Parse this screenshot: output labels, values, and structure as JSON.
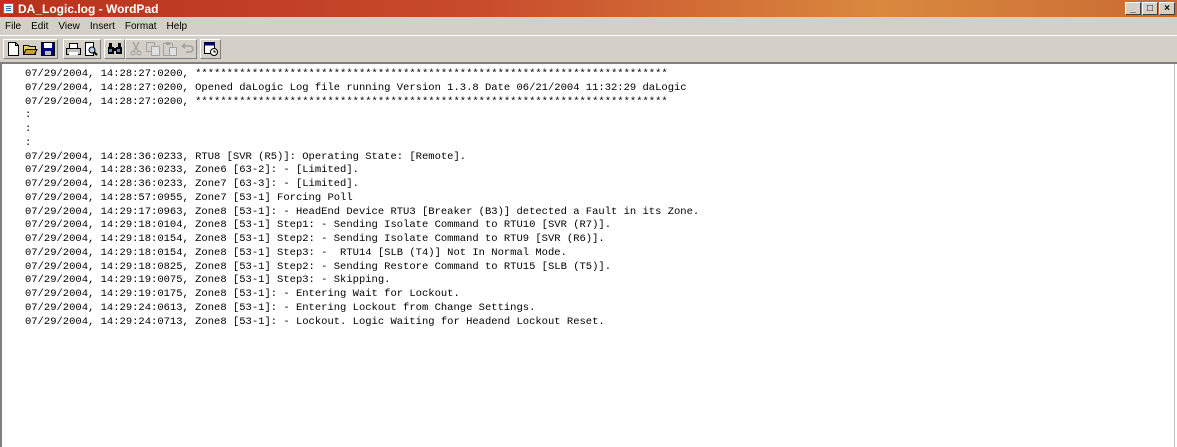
{
  "window": {
    "title": "DA_Logic.log - WordPad",
    "min_glyph": "_",
    "max_glyph": "□",
    "close_glyph": "×"
  },
  "menu": [
    "File",
    "Edit",
    "View",
    "Insert",
    "Format",
    "Help"
  ],
  "toolbar": {
    "buttons": [
      {
        "name": "new-document-icon",
        "enabled": true
      },
      {
        "name": "open-folder-icon",
        "enabled": true
      },
      {
        "name": "save-icon",
        "enabled": true
      },
      {
        "name": "print-icon",
        "enabled": true
      },
      {
        "name": "print-preview-icon",
        "enabled": true
      },
      {
        "name": "find-icon",
        "enabled": true
      },
      {
        "name": "cut-icon",
        "enabled": false
      },
      {
        "name": "copy-icon",
        "enabled": false
      },
      {
        "name": "paste-icon",
        "enabled": false
      },
      {
        "name": "undo-icon",
        "enabled": false
      },
      {
        "name": "insert-datetime-icon",
        "enabled": true
      }
    ]
  },
  "document": {
    "lines": [
      "07/29/2004, 14:28:27:0200, ***************************************************************************",
      "07/29/2004, 14:28:27:0200, Opened daLogic Log file running Version 1.3.8 Date 06/21/2004 11:32:29 daLogic",
      "07/29/2004, 14:28:27:0200, ***************************************************************************",
      ":",
      ":",
      ":",
      "07/29/2004, 14:28:36:0233, RTU8 [SVR (R5)]: Operating State: [Remote].",
      "07/29/2004, 14:28:36:0233, Zone6 [63-2]: - [Limited].",
      "07/29/2004, 14:28:36:0233, Zone7 [63-3]: - [Limited].",
      "07/29/2004, 14:28:57:0955, Zone7 [53-1] Forcing Poll",
      "07/29/2004, 14:29:17:0963, Zone8 [53-1]: - HeadEnd Device RTU3 [Breaker (B3)] detected a Fault in its Zone.",
      "07/29/2004, 14:29:18:0104, Zone8 [53-1] Step1: - Sending Isolate Command to RTU10 [SVR (R7)].",
      "07/29/2004, 14:29:18:0154, Zone8 [53-1] Step2: - Sending Isolate Command to RTU9 [SVR (R6)].",
      "07/29/2004, 14:29:18:0154, Zone8 [53-1] Step3: -  RTU14 [SLB (T4)] Not In Normal Mode.",
      "07/29/2004, 14:29:18:0825, Zone8 [53-1] Step2: - Sending Restore Command to RTU15 [SLB (T5)].",
      "07/29/2004, 14:29:19:0075, Zone8 [53-1] Step3: - Skipping.",
      "07/29/2004, 14:29:19:0175, Zone8 [53-1]: - Entering Wait for Lockout.",
      "07/29/2004, 14:29:24:0613, Zone8 [53-1]: - Entering Lockout from Change Settings.",
      "07/29/2004, 14:29:24:0713, Zone8 [53-1]: - Lockout. Logic Waiting for Headend Lockout Reset."
    ]
  }
}
